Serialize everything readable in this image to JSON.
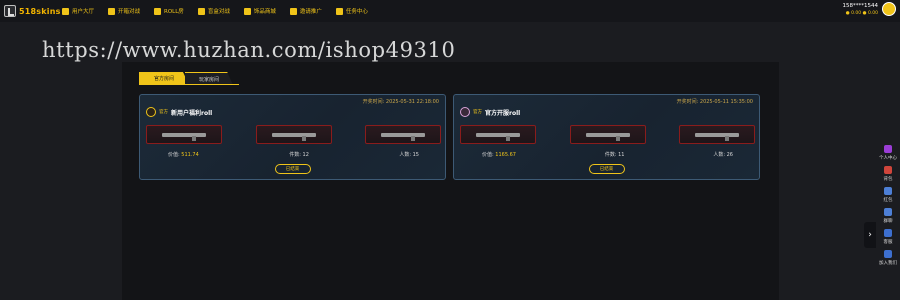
{
  "header": {
    "logo_text": "518skins",
    "nav": [
      {
        "label": "用户大厅",
        "icon": "hall-icon"
      },
      {
        "label": "开箱对战",
        "icon": "battle-icon"
      },
      {
        "label": "ROLL房",
        "icon": "roll-icon"
      },
      {
        "label": "盲盒对战",
        "icon": "blindbox-icon"
      },
      {
        "label": "饰品商城",
        "icon": "shop-icon"
      },
      {
        "label": "邀请推广",
        "icon": "invite-icon"
      },
      {
        "label": "任务中心",
        "icon": "task-icon"
      }
    ],
    "user": {
      "name": "158****1544",
      "balance": "0.00",
      "points": "0.00"
    }
  },
  "watermark": "https://www.huzhan.com/ishop49310",
  "tabs": [
    {
      "label": "官方房间"
    },
    {
      "label": "玩家房间"
    }
  ],
  "cards": [
    {
      "tag": "官方",
      "title": "新用户福利roll",
      "time": "开奖时间: 2025-05-31 22:18:00",
      "prizes": [
        "",
        "",
        ""
      ],
      "stats": {
        "value_label": "价值:",
        "value": "511.74",
        "items_label": "件数:",
        "items": "12",
        "people_label": "人数:",
        "people": "15"
      },
      "button": "已结束"
    },
    {
      "tag": "官方",
      "title": "官方开服roll",
      "time": "开奖时间: 2025-05-11 15:35:00",
      "prizes": [
        "",
        "",
        ""
      ],
      "stats": {
        "value_label": "价值:",
        "value": "1165.67",
        "items_label": "件数:",
        "items": "11",
        "people_label": "人数:",
        "people": "26"
      },
      "button": "已结束"
    }
  ],
  "right_sidebar": [
    {
      "label": "个人中心",
      "icon": "user-icon",
      "color": "#9b3dd6"
    },
    {
      "label": "背包",
      "icon": "bag-icon",
      "color": "#d0453b"
    },
    {
      "label": "红包",
      "icon": "redpacket-icon",
      "color": "#4d7fd6"
    },
    {
      "label": "群聊",
      "icon": "chat-icon",
      "color": "#4d7fd6"
    },
    {
      "label": "客服",
      "icon": "service-icon",
      "color": "#3d6fcf"
    },
    {
      "label": "加入我们",
      "icon": "join-icon",
      "color": "#3d6fcf"
    }
  ]
}
